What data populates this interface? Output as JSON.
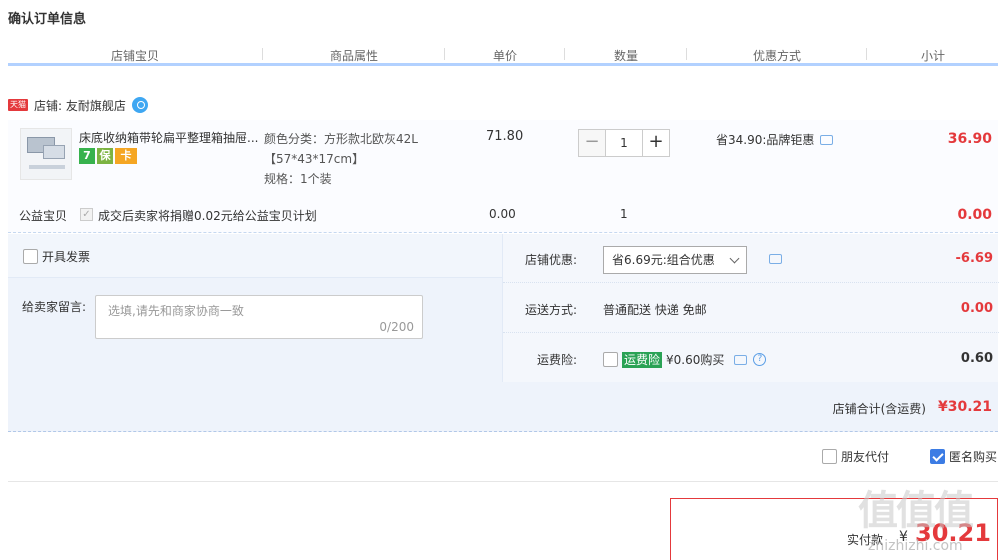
{
  "page": {
    "title": "确认订单信息"
  },
  "table_header": {
    "columns": [
      "店铺宝贝",
      "商品属性",
      "单价",
      "数量",
      "优惠方式",
      "小计"
    ]
  },
  "shop": {
    "badge": "天猫",
    "label": "店铺: 友耐旗舰店"
  },
  "item": {
    "name": "床底收纳箱带轮扁平整理箱抽屉...",
    "promo_icons": [
      "7",
      "保",
      "卡"
    ],
    "attr_color": "颜色分类：方形款北欧灰42L【57*43*17cm】",
    "attr_spec": "规格：1个装",
    "unit_price": "71.80",
    "quantity": "1",
    "minus": "−",
    "plus": "+",
    "discount": "省34.90:品牌钜惠",
    "subtotal": "36.90"
  },
  "charity": {
    "label": "公益宝贝",
    "check_mark": "✓",
    "text": "成交后卖家将捐赠0.02元给公益宝贝计划",
    "price": "0.00",
    "quantity": "1",
    "subtotal": "0.00"
  },
  "options": {
    "invoice_label": "开具发票",
    "message_label": "给卖家留言:",
    "message_placeholder": "选填,请先和商家协商一致",
    "message_count": "0/200",
    "shop_discount_label": "店铺优惠:",
    "shop_discount_selected": "省6.69元:组合优惠",
    "shop_discount_value": "-6.69",
    "shipping_label": "运送方式:",
    "shipping_text": "普通配送 快递 免邮",
    "shipping_value": "0.00",
    "insurance_label": "运费险:",
    "insurance_badge": "运费险",
    "insurance_text": "¥0.60购买",
    "insurance_help": "?",
    "insurance_value": "0.60"
  },
  "total": {
    "label": "店铺合计(含运费)",
    "value": "¥30.21"
  },
  "footer": {
    "friend_pay": "朋友代付",
    "anonymous_buy": "匿名购买",
    "pay_label": "实付款",
    "pay_currency": "¥",
    "pay_value": "30.21"
  },
  "watermark": {
    "main": "值值值",
    "sub": "zhizhizhi.com"
  },
  "colors": {
    "accent_red": "#e4393c",
    "header_blue": "#b2d1ff",
    "check_blue": "#3c7ce4"
  }
}
